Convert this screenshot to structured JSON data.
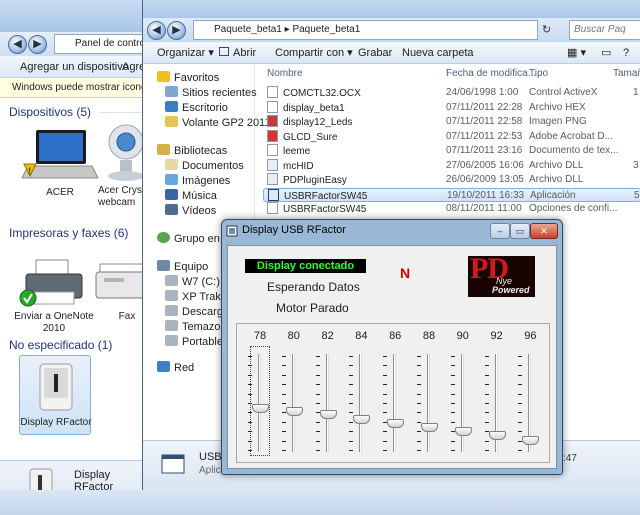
{
  "devices_window": {
    "address": "Panel de control",
    "command_bar": [
      "Agregar un dispositivo",
      "Agreg"
    ],
    "info_bar": "Windows puede mostrar iconos de",
    "groups": [
      {
        "title": "Dispositivos (5)",
        "items": [
          "ACER",
          "Acer Crysta webcam"
        ]
      },
      {
        "title": "Impresoras y faxes (6)",
        "items": [
          "Enviar a OneNote 2010",
          "Fax"
        ]
      },
      {
        "title": "No especificado (1)",
        "items": [
          "Display RFactor"
        ]
      }
    ],
    "footer_label": "Display RFactor"
  },
  "explorer_window": {
    "breadcrumb": [
      "Paquete_beta1",
      "Paquete_beta1"
    ],
    "search_placeholder": "Buscar Paq",
    "commands": [
      "Organizar",
      "Abrir",
      "Compartir con",
      "Grabar",
      "Nueva carpeta"
    ],
    "favorites_title": "Favoritos",
    "favorites": [
      "Sitios recientes",
      "Escritorio",
      "Volante GP2 2011"
    ],
    "libraries_title": "Bibliotecas",
    "libraries": [
      "Documentos",
      "Imágenes",
      "Música",
      "Vídeos"
    ],
    "homegroup": "Grupo en el h",
    "computer_title": "Equipo",
    "drives": [
      "W7 (C:)",
      "XP Traktor (",
      "Descargas (",
      "Temazos (F",
      "Portable (J:"
    ],
    "network": "Red",
    "columns": [
      "Nombre",
      "Fecha de modifica...",
      "Tipo",
      "Tamañ"
    ],
    "files": [
      {
        "name": "COMCTL32.OCX",
        "date": "24/06/1998 1:00",
        "type": "Control ActiveX",
        "size": "1",
        "icon": "ocx-icon"
      },
      {
        "name": "display_beta1",
        "date": "07/11/2011 22:28",
        "type": "Archivo HEX",
        "size": "",
        "icon": "hex-file-icon"
      },
      {
        "name": "display12_Leds",
        "date": "07/11/2011 22:58",
        "type": "Imagen PNG",
        "size": "",
        "icon": "png-file-icon"
      },
      {
        "name": "GLCD_Sure",
        "date": "07/11/2011 22:53",
        "type": "Adobe Acrobat D...",
        "size": "",
        "icon": "pdf-file-icon"
      },
      {
        "name": "leeme",
        "date": "07/11/2011 23:16",
        "type": "Documento de tex...",
        "size": "",
        "icon": "text-file-icon"
      },
      {
        "name": "mcHID",
        "date": "27/06/2005 16:06",
        "type": "Archivo DLL",
        "size": "3",
        "icon": "dll-file-icon"
      },
      {
        "name": "PDPluginEasy",
        "date": "26/06/2009 13:05",
        "type": "Archivo DLL",
        "size": "",
        "icon": "dll-file-icon"
      },
      {
        "name": "USBRFactorSW45",
        "date": "19/10/2011 16:33",
        "type": "Aplicación",
        "size": "5",
        "icon": "exe-file-icon"
      },
      {
        "name": "USBRFactorSW45",
        "date": "08/11/2011 11:00",
        "type": "Opciones de confi...",
        "size": "",
        "icon": "config-file-icon"
      }
    ],
    "details_name": "USBR",
    "details_type": "Aplica",
    "details_time": ":47"
  },
  "app_window": {
    "title": "Display USB RFactor",
    "status": "Display conectado",
    "gear": "N",
    "data_status": "Esperando Datos",
    "motor_status": "Motor Parado",
    "logo_text": "PD",
    "logo_sub1": "Nye",
    "logo_sub2": "Powered",
    "sliders": [
      {
        "label": "78",
        "level": 0.43
      },
      {
        "label": "80",
        "level": 0.4
      },
      {
        "label": "82",
        "level": 0.36
      },
      {
        "label": "84",
        "level": 0.31
      },
      {
        "label": "86",
        "level": 0.26
      },
      {
        "label": "88",
        "level": 0.22
      },
      {
        "label": "90",
        "level": 0.17
      },
      {
        "label": "92",
        "level": 0.12
      },
      {
        "label": "96",
        "level": 0.07
      }
    ]
  }
}
